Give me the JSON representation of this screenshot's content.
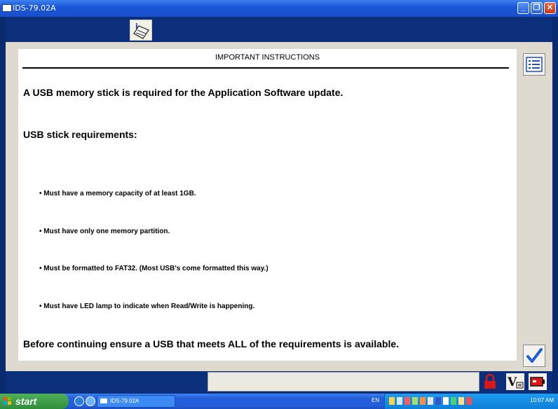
{
  "window": {
    "title": "IDS-79.02A"
  },
  "content": {
    "header": "IMPORTANT INSTRUCTIONS",
    "intro": "A USB memory stick is required for the Application Software update.",
    "requirements_heading": "USB stick requirements:",
    "requirements": [
      "• Must have a memory capacity of at least 1GB.",
      "• Must have only one memory partition.",
      "• Must be formatted to FAT32. (Most USB's come formatted this way.)",
      "• Must have LED lamp to indicate when Read/Write is happening."
    ],
    "footer": "Before continuing ensure a USB that meets ALL of the requirements is available."
  },
  "taskbar": {
    "start_label": "start",
    "task_item": "IDS-79.02A",
    "language": "EN",
    "clock": "10:07 AM"
  },
  "colors": {
    "accent": "#0b2f7a",
    "check": "#1f5fd6"
  }
}
